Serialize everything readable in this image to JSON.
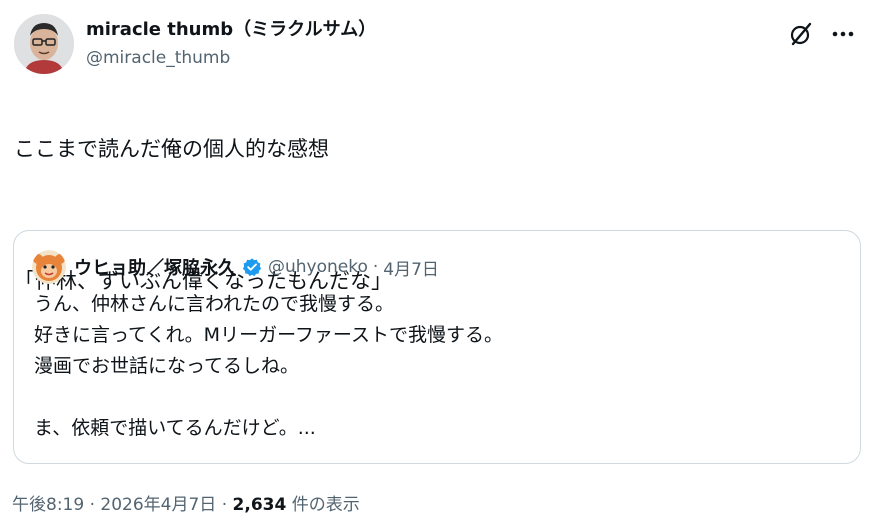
{
  "author": {
    "display_name": "miracle thumb（ミラクルサム）",
    "handle": "@miracle_thumb"
  },
  "icons": {
    "grok": "grok-icon",
    "more": "more-options-icon",
    "verified": "verified-badge-icon"
  },
  "tweet": {
    "lines": [
      "ここまで読んだ俺の個人的な感想",
      "",
      "「仲林、ずいぶん偉くなったもんだな」"
    ]
  },
  "quote": {
    "display_name": "ウヒョ助／塚脇永久",
    "handle": "@uhyoneko",
    "separator": "·",
    "date": "4月7日",
    "lines": [
      "うん、仲林さんに言われたので我慢する。",
      "好きに言ってくれ。Mリーガーファーストで我慢する。",
      "漫画でお世話になってるしね。",
      "",
      "ま、依頼で描いてるんだけど。..."
    ]
  },
  "meta": {
    "time": "午後8:19",
    "sep1": " · ",
    "date": "2026年4月7日",
    "sep2": " · ",
    "views_count": "2,634",
    "views_label": " 件の表示"
  },
  "colors": {
    "text": "#0f1419",
    "secondary": "#536471",
    "border": "#cfd9de",
    "verified_blue": "#1d9bf0"
  }
}
